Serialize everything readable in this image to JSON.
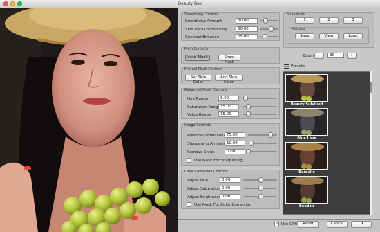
{
  "window": {
    "title": "Beauty Box"
  },
  "smoothing": {
    "title": "Smoothing Controls",
    "rows": [
      {
        "label": "Smoothing Amount",
        "value": "30.00",
        "level": 0.3
      },
      {
        "label": "Skin Detail Smoothing",
        "value": "60.00",
        "level": 0.6
      },
      {
        "label": "Contrast Enhance",
        "value": "25.00",
        "level": 0.25
      }
    ]
  },
  "snapshots": {
    "title": "Snapshots",
    "buttons": [
      "1",
      "2",
      "3"
    ],
    "actions_title": "Actions",
    "actions": [
      "Save",
      "View",
      "Load"
    ]
  },
  "main_controls": {
    "title": "Main Controls",
    "auto_mask": "Auto-Mask",
    "show_mask": "Show Mask"
  },
  "zoom": {
    "label": "Zoom",
    "minus": "-",
    "value": "80",
    "plus": "+"
  },
  "manual_mask": {
    "title": "Manual Mask Controls",
    "set_skin": "Set Skin Color",
    "add_skin": "Add Skin Color"
  },
  "presets": {
    "title": "Presets",
    "items": [
      {
        "label": "Beauty Subdued",
        "tint": "#6b4b3f"
      },
      {
        "label": "Blue Love",
        "tint": "#4a4a55"
      },
      {
        "label": "Bordello",
        "tint": "#6a4030"
      },
      {
        "label": "Boudoir",
        "tint": "#553b33"
      }
    ]
  },
  "advanced_mask": {
    "title": "Advanced Mask Controls",
    "rows": [
      {
        "label": "Hue Range",
        "value": "8.00",
        "level": 0.08
      },
      {
        "label": "Saturation Range",
        "value": "15.00",
        "level": 0.15
      },
      {
        "label": "Value Range",
        "value": "15.00",
        "level": 0.15
      }
    ]
  },
  "image_controls": {
    "title": "Image Controls",
    "rows": [
      {
        "label": "Preserve Small Detail",
        "value": "75.00",
        "level": 0.75
      },
      {
        "label": "Sharpening Amount",
        "value": "10.00",
        "level": 0.1
      },
      {
        "label": "Remove Shine",
        "value": "0.00",
        "level": 0.0
      }
    ],
    "checkbox": {
      "label": "Use Mask For Sharpening",
      "checked": false
    }
  },
  "color_correction": {
    "title": "Color Correction Controls",
    "rows": [
      {
        "label": "Adjust Hue",
        "value": "0.00",
        "level": 0.5
      },
      {
        "label": "Adjust Saturation",
        "value": "0.00",
        "level": 0.5
      },
      {
        "label": "Adjust Brightness",
        "value": "0.00",
        "level": 0.5
      }
    ],
    "checkbox": {
      "label": "Use Mask For Color Correction",
      "checked": false
    }
  },
  "bottom": {
    "use_gpu": {
      "label": "Use GPU",
      "checked": true
    },
    "reset": "Reset",
    "cancel": "Cancel",
    "ok": "OK"
  },
  "colors": {
    "panel_bg": "#c8c8c8",
    "group_bg": "#bdbdbd",
    "list_bg": "#3d3d3d",
    "accent": "#1d4ed8"
  }
}
